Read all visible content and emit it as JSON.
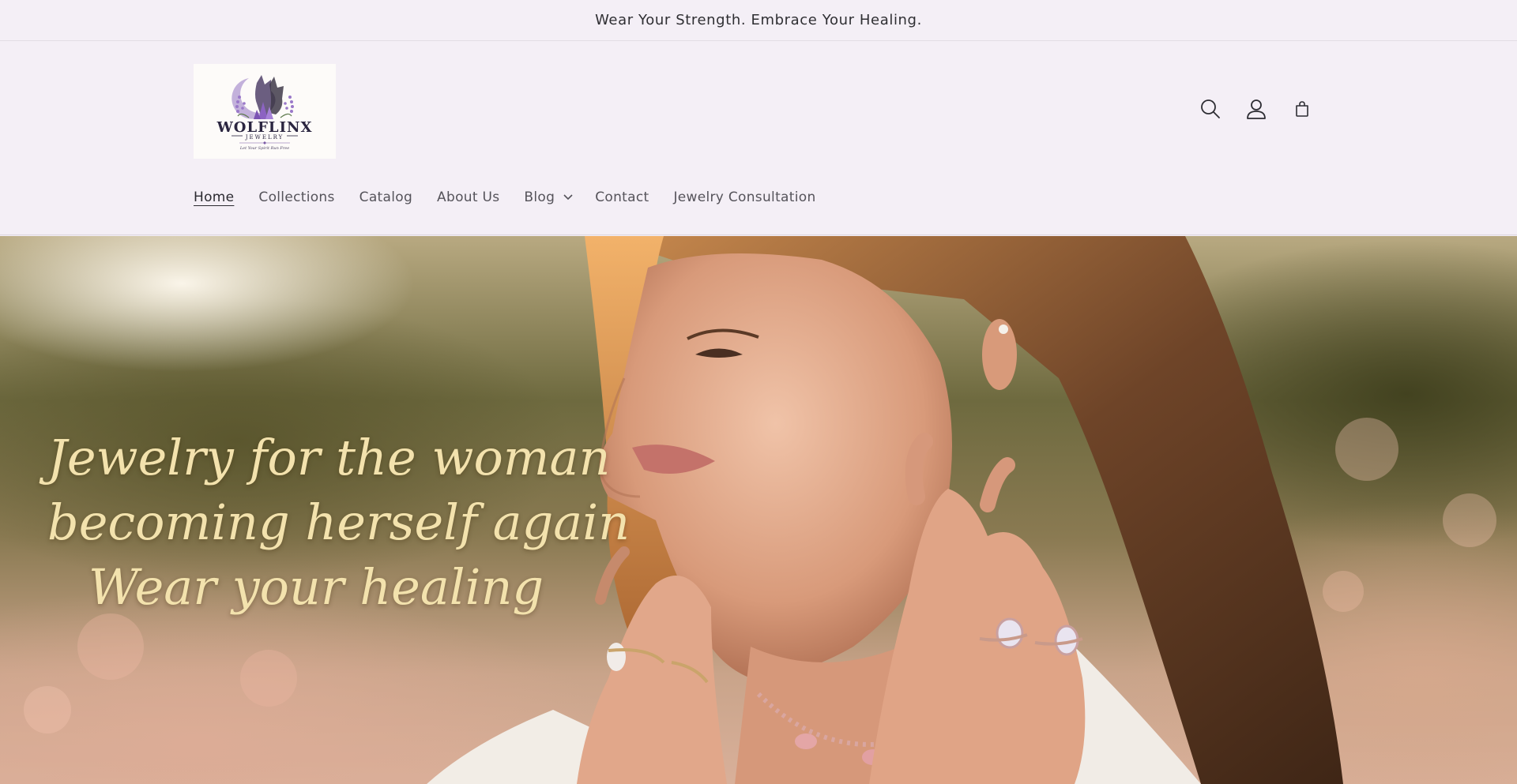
{
  "announcement": {
    "text": "Wear Your Strength. Embrace Your Healing."
  },
  "logo": {
    "brand": "WOLFLINX",
    "sub": "JEWELRY",
    "tagline": "Let Your Spirit Run Free"
  },
  "header_icons": [
    "search-icon",
    "account-icon",
    "cart-icon"
  ],
  "nav": {
    "home": "Home",
    "collections": "Collections",
    "catalog": "Catalog",
    "about": "About Us",
    "blog": "Blog",
    "contact": "Contact",
    "consultation": "Jewelry Consultation"
  },
  "hero": {
    "line1": "Jewelry for the woman",
    "line2": "becoming herself again",
    "line3": "Wear your healing"
  },
  "colors": {
    "background": "#f4eff6",
    "nav_text": "#55535a",
    "hero_text": "#f3e2ad",
    "brand_purple": "#7b5aa6"
  }
}
